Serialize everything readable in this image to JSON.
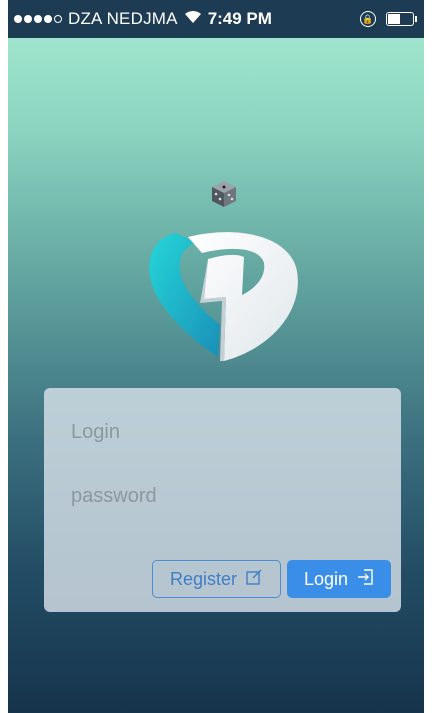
{
  "status_bar": {
    "carrier": "DZA NEDJMA",
    "time": "7:49 PM",
    "signal_bars_filled": 4,
    "signal_bars_total": 5,
    "battery_level": 0.45,
    "icons": [
      "wifi-icon",
      "rotation-lock-icon",
      "battery-icon"
    ]
  },
  "logo": {
    "icons": [
      "dice-icon",
      "app-logo-d"
    ]
  },
  "colors": {
    "gradient_top": "#a7ecd2",
    "gradient_bottom": "#16344c",
    "card_bg": "#d7e1e8",
    "primary_button": "#3a8ee8",
    "register_border": "#4a8fd3"
  },
  "form": {
    "login_placeholder": "Login",
    "password_placeholder": "password",
    "register_label": "Register",
    "register_icon": "edit-icon",
    "login_label": "Login",
    "login_icon": "sign-in-icon"
  }
}
